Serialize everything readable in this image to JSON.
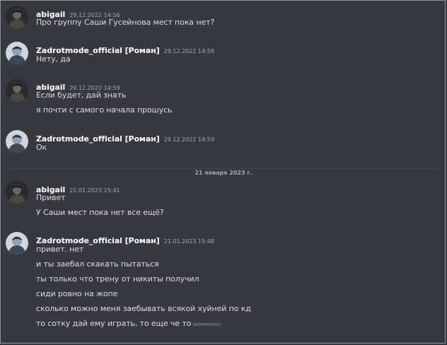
{
  "messages": [
    {
      "author": "abigail",
      "timestamp": "29.12.2022 14:56",
      "lines": [
        "Про группу Саши Гусейнова мест пока нет?"
      ]
    },
    {
      "author": "Zadrotmode_official [Роман]",
      "timestamp": "29.12.2022 14:58",
      "lines": [
        "Нету, да"
      ]
    },
    {
      "author": "abigail",
      "timestamp": "29.12.2022 14:59",
      "lines": [
        "Если будет, дай знать",
        "я почти с самого начала прошусь"
      ]
    },
    {
      "author": "Zadrotmode_official [Роман]",
      "timestamp": "29.12.2022 14:59",
      "lines": [
        "Ок"
      ]
    },
    {
      "author": "abigail",
      "timestamp": "21.01.2023 15:41",
      "lines": [
        "Привет",
        "У Саши мест пока нет все ещё?"
      ]
    },
    {
      "author": "Zadrotmode_official [Роман]",
      "timestamp": "21.01.2023 15:48",
      "lines": [
        "привет. нет",
        "и ты заебал скакать пытаться",
        "ты только что трену от никиты получил",
        "сиди ровно на жопе",
        "сколько можно меня заебывать всякой хуйней по кд",
        "то сотку дай ему играть, то еще че то"
      ],
      "edited_label": "(изменено)"
    }
  ],
  "date_divider": "21 января 2023 г.",
  "colors": {
    "background": "#36393f",
    "username": "#ffffff",
    "message_text": "#dcddde",
    "timestamp": "#a3a6aa"
  },
  "icons": {
    "abigail_avatar": "user-avatar-dark",
    "roman_avatar": "user-avatar-light"
  }
}
